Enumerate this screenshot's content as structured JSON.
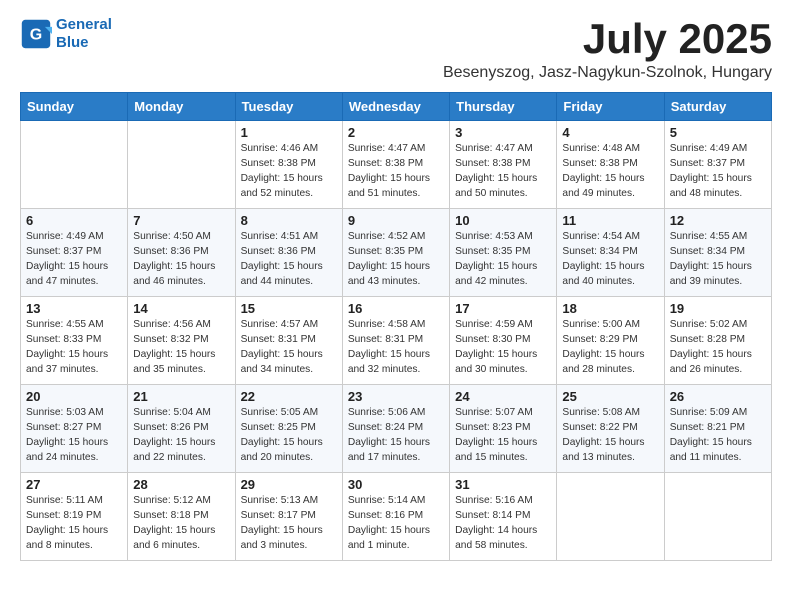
{
  "header": {
    "logo_line1": "General",
    "logo_line2": "Blue",
    "month_title": "July 2025",
    "location": "Besenyszog, Jasz-Nagykun-Szolnok, Hungary"
  },
  "weekdays": [
    "Sunday",
    "Monday",
    "Tuesday",
    "Wednesday",
    "Thursday",
    "Friday",
    "Saturday"
  ],
  "weeks": [
    [
      {
        "day": "",
        "info": ""
      },
      {
        "day": "",
        "info": ""
      },
      {
        "day": "1",
        "info": "Sunrise: 4:46 AM\nSunset: 8:38 PM\nDaylight: 15 hours and 52 minutes."
      },
      {
        "day": "2",
        "info": "Sunrise: 4:47 AM\nSunset: 8:38 PM\nDaylight: 15 hours and 51 minutes."
      },
      {
        "day": "3",
        "info": "Sunrise: 4:47 AM\nSunset: 8:38 PM\nDaylight: 15 hours and 50 minutes."
      },
      {
        "day": "4",
        "info": "Sunrise: 4:48 AM\nSunset: 8:38 PM\nDaylight: 15 hours and 49 minutes."
      },
      {
        "day": "5",
        "info": "Sunrise: 4:49 AM\nSunset: 8:37 PM\nDaylight: 15 hours and 48 minutes."
      }
    ],
    [
      {
        "day": "6",
        "info": "Sunrise: 4:49 AM\nSunset: 8:37 PM\nDaylight: 15 hours and 47 minutes."
      },
      {
        "day": "7",
        "info": "Sunrise: 4:50 AM\nSunset: 8:36 PM\nDaylight: 15 hours and 46 minutes."
      },
      {
        "day": "8",
        "info": "Sunrise: 4:51 AM\nSunset: 8:36 PM\nDaylight: 15 hours and 44 minutes."
      },
      {
        "day": "9",
        "info": "Sunrise: 4:52 AM\nSunset: 8:35 PM\nDaylight: 15 hours and 43 minutes."
      },
      {
        "day": "10",
        "info": "Sunrise: 4:53 AM\nSunset: 8:35 PM\nDaylight: 15 hours and 42 minutes."
      },
      {
        "day": "11",
        "info": "Sunrise: 4:54 AM\nSunset: 8:34 PM\nDaylight: 15 hours and 40 minutes."
      },
      {
        "day": "12",
        "info": "Sunrise: 4:55 AM\nSunset: 8:34 PM\nDaylight: 15 hours and 39 minutes."
      }
    ],
    [
      {
        "day": "13",
        "info": "Sunrise: 4:55 AM\nSunset: 8:33 PM\nDaylight: 15 hours and 37 minutes."
      },
      {
        "day": "14",
        "info": "Sunrise: 4:56 AM\nSunset: 8:32 PM\nDaylight: 15 hours and 35 minutes."
      },
      {
        "day": "15",
        "info": "Sunrise: 4:57 AM\nSunset: 8:31 PM\nDaylight: 15 hours and 34 minutes."
      },
      {
        "day": "16",
        "info": "Sunrise: 4:58 AM\nSunset: 8:31 PM\nDaylight: 15 hours and 32 minutes."
      },
      {
        "day": "17",
        "info": "Sunrise: 4:59 AM\nSunset: 8:30 PM\nDaylight: 15 hours and 30 minutes."
      },
      {
        "day": "18",
        "info": "Sunrise: 5:00 AM\nSunset: 8:29 PM\nDaylight: 15 hours and 28 minutes."
      },
      {
        "day": "19",
        "info": "Sunrise: 5:02 AM\nSunset: 8:28 PM\nDaylight: 15 hours and 26 minutes."
      }
    ],
    [
      {
        "day": "20",
        "info": "Sunrise: 5:03 AM\nSunset: 8:27 PM\nDaylight: 15 hours and 24 minutes."
      },
      {
        "day": "21",
        "info": "Sunrise: 5:04 AM\nSunset: 8:26 PM\nDaylight: 15 hours and 22 minutes."
      },
      {
        "day": "22",
        "info": "Sunrise: 5:05 AM\nSunset: 8:25 PM\nDaylight: 15 hours and 20 minutes."
      },
      {
        "day": "23",
        "info": "Sunrise: 5:06 AM\nSunset: 8:24 PM\nDaylight: 15 hours and 17 minutes."
      },
      {
        "day": "24",
        "info": "Sunrise: 5:07 AM\nSunset: 8:23 PM\nDaylight: 15 hours and 15 minutes."
      },
      {
        "day": "25",
        "info": "Sunrise: 5:08 AM\nSunset: 8:22 PM\nDaylight: 15 hours and 13 minutes."
      },
      {
        "day": "26",
        "info": "Sunrise: 5:09 AM\nSunset: 8:21 PM\nDaylight: 15 hours and 11 minutes."
      }
    ],
    [
      {
        "day": "27",
        "info": "Sunrise: 5:11 AM\nSunset: 8:19 PM\nDaylight: 15 hours and 8 minutes."
      },
      {
        "day": "28",
        "info": "Sunrise: 5:12 AM\nSunset: 8:18 PM\nDaylight: 15 hours and 6 minutes."
      },
      {
        "day": "29",
        "info": "Sunrise: 5:13 AM\nSunset: 8:17 PM\nDaylight: 15 hours and 3 minutes."
      },
      {
        "day": "30",
        "info": "Sunrise: 5:14 AM\nSunset: 8:16 PM\nDaylight: 15 hours and 1 minute."
      },
      {
        "day": "31",
        "info": "Sunrise: 5:16 AM\nSunset: 8:14 PM\nDaylight: 14 hours and 58 minutes."
      },
      {
        "day": "",
        "info": ""
      },
      {
        "day": "",
        "info": ""
      }
    ]
  ]
}
